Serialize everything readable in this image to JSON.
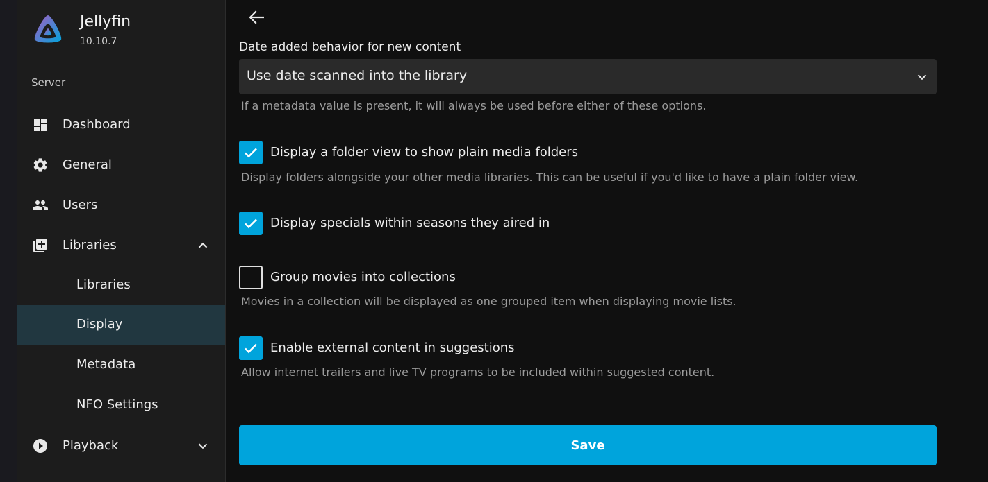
{
  "app": {
    "name": "Jellyfin",
    "version": "10.10.7"
  },
  "sidebar": {
    "section": "Server",
    "items": [
      {
        "label": "Dashboard",
        "icon": "dashboard-icon"
      },
      {
        "label": "General",
        "icon": "gear-icon"
      },
      {
        "label": "Users",
        "icon": "users-icon"
      },
      {
        "label": "Libraries",
        "icon": "library-add-icon",
        "expanded": true
      },
      {
        "label": "Playback",
        "icon": "play-circle-icon",
        "expanded": false
      }
    ],
    "subitems": [
      {
        "label": "Libraries",
        "active": false
      },
      {
        "label": "Display",
        "active": true
      },
      {
        "label": "Metadata",
        "active": false
      },
      {
        "label": "NFO Settings",
        "active": false
      }
    ]
  },
  "main": {
    "date_added": {
      "label": "Date added behavior for new content",
      "value": "Use date scanned into the library",
      "help": "If a metadata value is present, it will always be used before either of these options."
    },
    "options": [
      {
        "label": "Display a folder view to show plain media folders",
        "checked": true,
        "help": "Display folders alongside your other media libraries. This can be useful if you'd like to have a plain folder view."
      },
      {
        "label": "Display specials within seasons they aired in",
        "checked": true,
        "help": ""
      },
      {
        "label": "Group movies into collections",
        "checked": false,
        "help": "Movies in a collection will be displayed as one grouped item when displaying movie lists."
      },
      {
        "label": "Enable external content in suggestions",
        "checked": true,
        "help": "Allow internet trailers and live TV programs to be included within suggested content."
      }
    ],
    "save_label": "Save"
  },
  "colors": {
    "accent": "#00a4dc",
    "active_nav": "#213740",
    "background": "#101010",
    "sidebar": "#1c1c1c"
  }
}
